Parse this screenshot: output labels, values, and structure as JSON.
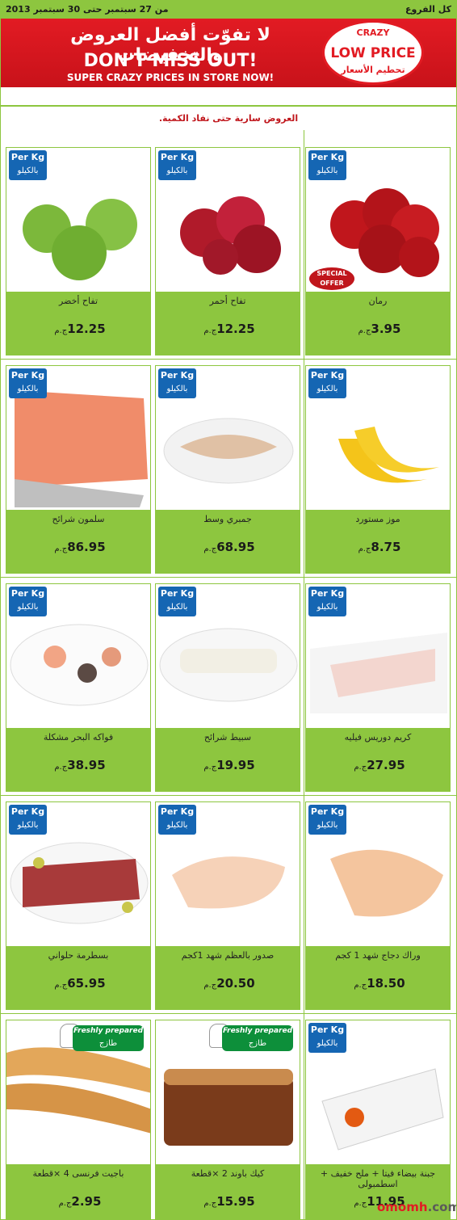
{
  "header": {
    "branches_link": "كل الفروع",
    "date_range": "من 27 سبتمبر حتى 30 سبتمبر 2013"
  },
  "banner": {
    "arabic_headline": "لا تفوّت أفضل العروض والتخفيضات",
    "headline": "DON'T MISS OUT!",
    "subheadline": "SUPER CRAZY PRICES IN STORE NOW!",
    "seal_top": "CRAZY",
    "seal_main": "LOW PRICE",
    "seal_bottom": "تحطيم الأسعار",
    "accent_color": "#e21b23"
  },
  "notice": "العروض سارية حتى نفاد الكمية.",
  "badges": {
    "per_kg": "Per Kg",
    "per_kg_ar": "بالكيلو",
    "fresh_en": "Freshly prepared",
    "fresh_ar": "طازج",
    "special_offer": "SPECIAL OFFER"
  },
  "currency": "ج.م",
  "products": [
    {
      "name": "رمان",
      "price": "3.95",
      "badge": "per_kg",
      "special": true
    },
    {
      "name": "تفاح أحمر",
      "price": "12.25",
      "badge": "per_kg"
    },
    {
      "name": "تفاح أخضر",
      "price": "12.25",
      "badge": "per_kg"
    },
    {
      "name": "موز مستورد",
      "price": "8.75",
      "badge": "per_kg"
    },
    {
      "name": "جمبري وسط",
      "price": "68.95",
      "badge": "per_kg"
    },
    {
      "name": "سلمون شرائح",
      "price": "86.95",
      "badge": "per_kg"
    },
    {
      "name": "كريم دوريس فيليه",
      "price": "27.95",
      "badge": "per_kg"
    },
    {
      "name": "سبيط شرائح",
      "price": "19.95",
      "badge": "per_kg"
    },
    {
      "name": "فواكه البحر مشكلة",
      "price": "38.95",
      "badge": "per_kg"
    },
    {
      "name": "وراك دجاج شهد 1 كجم",
      "price": "18.50",
      "badge": "per_kg"
    },
    {
      "name": "صدور بالعظم شهد 1كجم",
      "price": "20.50",
      "badge": "per_kg"
    },
    {
      "name": "بسطرمة حلواني",
      "price": "65.95",
      "badge": "per_kg"
    },
    {
      "name": "جبنة بيضاء فيتا + ملح خفيف + اسطمبولى",
      "price": "11.95",
      "badge": "per_kg"
    },
    {
      "name": "كيك باوند 2 ×قطعة",
      "price": "15.95",
      "badge": "fresh"
    },
    {
      "name": "باجيت فرنسى 4 ×قطعة",
      "price": "2.95",
      "badge": "fresh"
    }
  ],
  "watermark": {
    "brand": "omomh",
    "suffix": ".com"
  },
  "colors": {
    "green": "#8dc63f",
    "blue_badge": "#1566b3",
    "red": "#c0161c"
  }
}
